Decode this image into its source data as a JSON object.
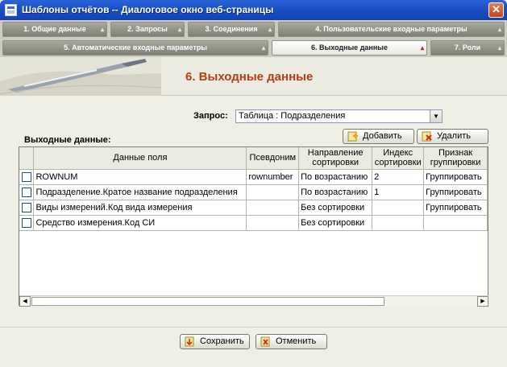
{
  "window": {
    "title": "Шаблоны отчётов -- Диалоговое окно веб-страницы",
    "close_glyph": "✕"
  },
  "tabs": {
    "row1": [
      {
        "label": "1. Общие данные",
        "active": false
      },
      {
        "label": "2. Запросы",
        "active": false
      },
      {
        "label": "3. Соединения",
        "active": false
      },
      {
        "label": "4. Пользовательские входные параметры",
        "active": false
      }
    ],
    "row2": [
      {
        "label": "5. Автоматические входные параметры",
        "active": false
      },
      {
        "label": "6. Выходные данные",
        "active": true
      },
      {
        "label": "7. Роли",
        "active": false
      }
    ]
  },
  "page": {
    "heading": "6. Выходные данные",
    "heading_color": "#b33e1a"
  },
  "query": {
    "label": "Запрос:",
    "selected": "Таблица : Подразделения"
  },
  "actions": {
    "add_label": "Добавить",
    "delete_label": "Удалить"
  },
  "output": {
    "label": "Выходные данные:",
    "columns": [
      "Данные поля",
      "Псевдоним",
      "Направление сортировки",
      "Индекс сортировки",
      "Признак группировки"
    ],
    "rows": [
      {
        "field": "ROWNUM",
        "alias": "rownumber",
        "sort_dir": "По возрастанию",
        "sort_idx": "2",
        "group": "Группировать"
      },
      {
        "field": "Подразделение.Кратое название подразделения",
        "alias": "",
        "sort_dir": "По возрастанию",
        "sort_idx": "1",
        "group": "Группировать"
      },
      {
        "field": "Виды измерений.Код вида измерения",
        "alias": "",
        "sort_dir": "Без сортировки",
        "sort_idx": "",
        "group": "Группировать"
      },
      {
        "field": "Средство измерения.Код СИ",
        "alias": "",
        "sort_dir": "Без сортировки",
        "sort_idx": "",
        "group": ""
      }
    ]
  },
  "footer": {
    "save_label": "Сохранить",
    "cancel_label": "Отменить"
  },
  "colors": {
    "titlebar": "#1b4fc4",
    "tab_inactive": "#7f7f75",
    "tab_active": "#ffffff",
    "checkbox_border": "#1c5180"
  }
}
